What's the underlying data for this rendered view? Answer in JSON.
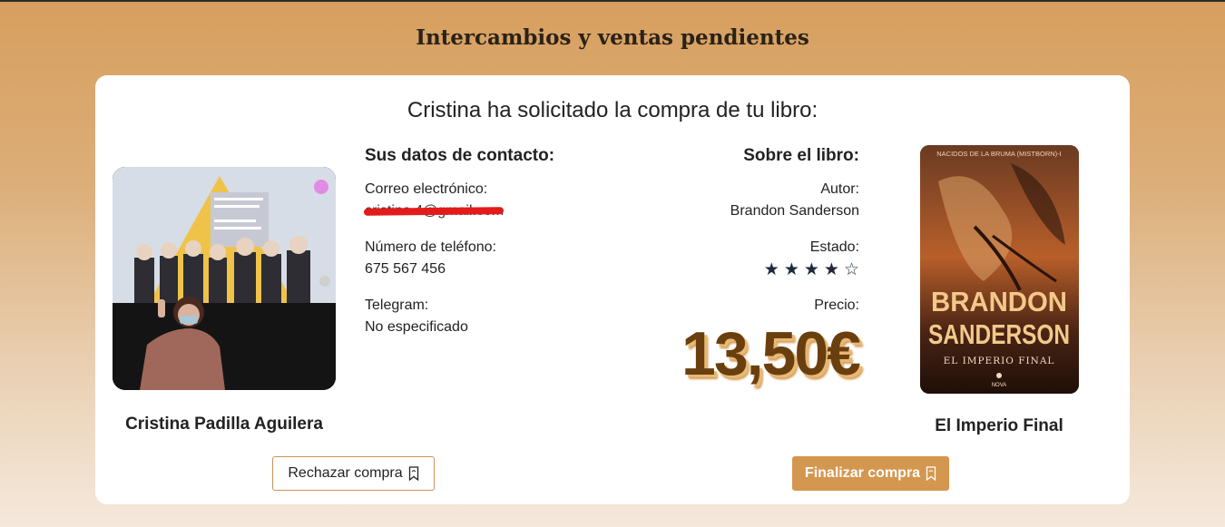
{
  "page": {
    "title": "Intercambios y ventas pendientes"
  },
  "request": {
    "heading": "Cristina ha solicitado la compra de tu libro:",
    "requester_name": "Cristina Padilla Aguilera"
  },
  "contact": {
    "section_title": "Sus datos de contacto:",
    "email_label": "Correo electrónico:",
    "email_value": "cristina.4@gmail.com",
    "phone_label": "Número de teléfono:",
    "phone_value": "675 567 456",
    "telegram_label": "Telegram:",
    "telegram_value": "No especificado"
  },
  "book": {
    "section_title": "Sobre el libro:",
    "author_label": "Autor:",
    "author_value": "Brandon Sanderson",
    "condition_label": "Estado:",
    "condition_rating": 4,
    "condition_max": 5,
    "price_label": "Precio:",
    "price_value": "13,50€",
    "title": "El Imperio Final",
    "cover": {
      "series": "NACIDOS DE LA BRUMA (MISTBORN)-I",
      "author_line1": "BRANDON",
      "author_line2": "SANDERSON",
      "title": "EL IMPERIO FINAL",
      "publisher": "NOVA"
    }
  },
  "actions": {
    "reject_label": "Rechazar compra",
    "finalize_label": "Finalizar compra"
  },
  "colors": {
    "accent": "#d4974f",
    "price_text": "#6a3f0f",
    "redaction": "#e31b1b"
  },
  "icons": {
    "bookmark": "bookmark-icon",
    "star_filled": "star-filled-icon",
    "star_empty": "star-empty-icon"
  }
}
